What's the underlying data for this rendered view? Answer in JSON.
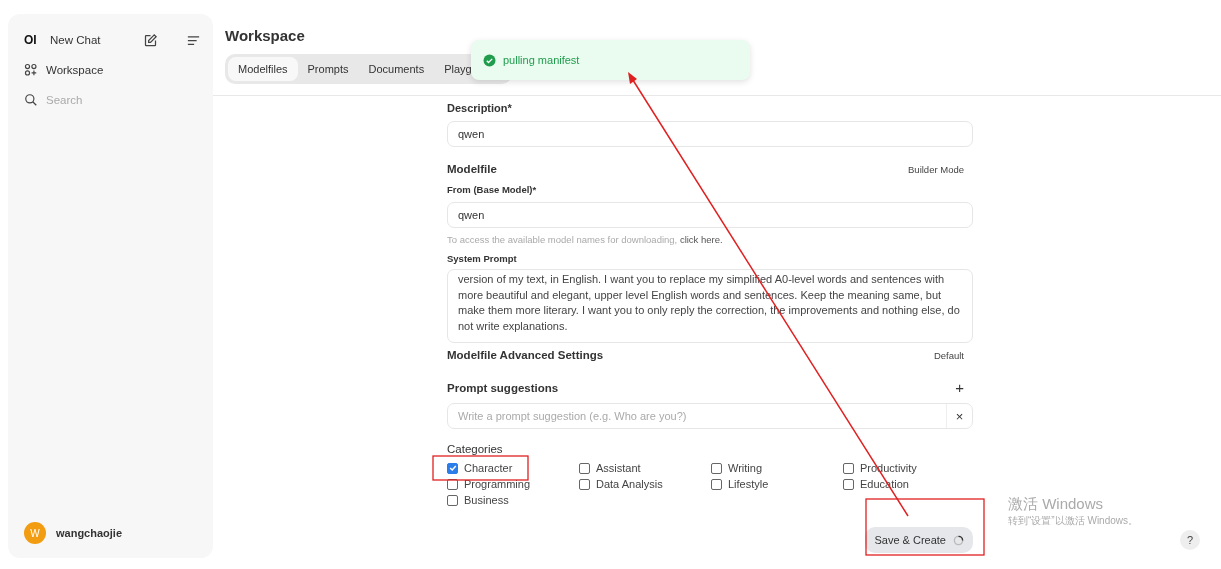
{
  "sidebar": {
    "logo": "OI",
    "new_chat": "New Chat",
    "items": [
      {
        "label": "Workspace"
      }
    ],
    "search": {
      "placeholder": "Search"
    },
    "user": {
      "initial": "W",
      "name": "wangchaojie"
    }
  },
  "header": {
    "title": "Workspace",
    "tabs": [
      {
        "label": "Modelfiles",
        "selected": true
      },
      {
        "label": "Prompts",
        "selected": false
      },
      {
        "label": "Documents",
        "selected": false
      },
      {
        "label": "Playg",
        "selected": false
      }
    ]
  },
  "toast": {
    "message": "pulling manifest"
  },
  "form": {
    "description": {
      "label": "Description*",
      "value": "qwen"
    },
    "modelfile": {
      "title": "Modelfile",
      "mode": "Builder Mode"
    },
    "base_model": {
      "label": "From (Base Model)*",
      "value": "qwen"
    },
    "hint": {
      "text": "To access the available model names for downloading,",
      "link": "click here."
    },
    "system_prompt": {
      "label": "System Prompt",
      "value": "version of my text, in English. I want you to replace my simplified A0-level words and sentences with more beautiful and elegant, upper level English words and sentences. Keep the meaning same, but make them more literary. I want you to only reply the correction, the improvements and nothing else, do not write explanations."
    },
    "advanced": {
      "title": "Modelfile Advanced Settings",
      "mode": "Default"
    },
    "prompt_suggestions": {
      "title": "Prompt suggestions",
      "add": "+",
      "placeholder": "Write a prompt suggestion (e.g. Who are you?)",
      "remove": "×"
    },
    "categories": {
      "title": "Categories",
      "items": [
        {
          "label": "Character",
          "checked": true
        },
        {
          "label": "Assistant",
          "checked": false
        },
        {
          "label": "Writing",
          "checked": false
        },
        {
          "label": "Productivity",
          "checked": false
        },
        {
          "label": "Programming",
          "checked": false
        },
        {
          "label": "Data Analysis",
          "checked": false
        },
        {
          "label": "Lifestyle",
          "checked": false
        },
        {
          "label": "Education",
          "checked": false
        },
        {
          "label": "Business",
          "checked": false
        }
      ]
    },
    "save_button": "Save & Create"
  },
  "activation_notice": {
    "title": "激活 Windows",
    "subtitle": "转到“设置”以激活 Windows。"
  },
  "help_button": "?"
}
